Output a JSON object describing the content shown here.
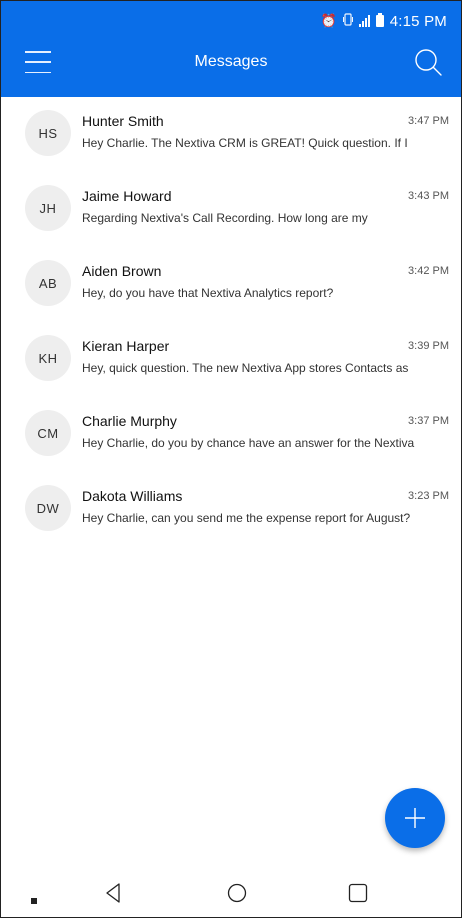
{
  "status": {
    "time": "4:15 PM",
    "icons": [
      "alarm-icon",
      "vibrate-icon",
      "signal-icon",
      "battery-icon"
    ]
  },
  "header": {
    "title": "Messages",
    "menu_icon": "hamburger-icon",
    "search_icon": "search-icon"
  },
  "conversations": [
    {
      "initials": "HS",
      "name": "Hunter Smith",
      "time": "3:47 PM",
      "preview": "Hey Charlie. The Nextiva CRM is GREAT! Quick question. If I"
    },
    {
      "initials": "JH",
      "name": "Jaime Howard",
      "time": "3:43 PM",
      "preview": "Regarding Nextiva's Call Recording. How long are my"
    },
    {
      "initials": "AB",
      "name": "Aiden Brown",
      "time": "3:42 PM",
      "preview": "Hey, do you have that Nextiva Analytics report?"
    },
    {
      "initials": "KH",
      "name": "Kieran Harper",
      "time": "3:39 PM",
      "preview": "Hey, quick question. The new Nextiva App stores Contacts as"
    },
    {
      "initials": "CM",
      "name": "Charlie Murphy",
      "time": "3:37 PM",
      "preview": "Hey Charlie, do you by chance have an answer for the Nextiva"
    },
    {
      "initials": "DW",
      "name": "Dakota Williams",
      "time": "3:23 PM",
      "preview": "Hey Charlie, can you send me the expense report for August?"
    }
  ],
  "fab": {
    "icon": "plus-icon"
  },
  "nav": {
    "icons": [
      "square-dot-icon",
      "back-icon",
      "home-icon",
      "recents-icon"
    ]
  },
  "colors": {
    "accent": "#0a6ee8",
    "avatar_bg": "#eeeeee"
  }
}
